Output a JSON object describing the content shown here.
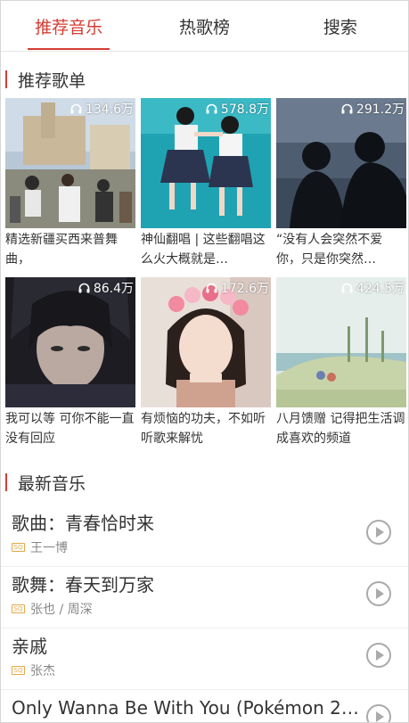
{
  "tabs": [
    {
      "label": "推荐音乐",
      "active": true
    },
    {
      "label": "热歌榜",
      "active": false
    },
    {
      "label": "搜索",
      "active": false
    }
  ],
  "sections": {
    "recommend": "推荐歌单",
    "latest": "最新音乐"
  },
  "playlists": [
    {
      "count": "134.6万",
      "title": "精选新疆买西来普舞曲，"
    },
    {
      "count": "578.8万",
      "title": "神仙翻唱 | 这些翻唱这么火大概就是…"
    },
    {
      "count": "291.2万",
      "title": "“没有人会突然不爱你，只是你突然…"
    },
    {
      "count": "86.4万",
      "title": "我可以等 可你不能一直没有回应"
    },
    {
      "count": "172.6万",
      "title": "有烦恼的功夫，不如听听歌来解忧"
    },
    {
      "count": "424.5万",
      "title": "八月馈赠 记得把生活调成喜欢的频道"
    }
  ],
  "songs": [
    {
      "name": "歌曲：青春恰时来",
      "artist": "王一博"
    },
    {
      "name": "歌舞：春天到万家",
      "artist": "张也 / 周深"
    },
    {
      "name": "亲戚",
      "artist": "张杰"
    },
    {
      "name": "Only Wanna Be With You (Pokémon 25…",
      "artist": ""
    }
  ],
  "icons": {
    "headphones": "headphones-icon",
    "sq": "sq-badge",
    "play": "play-icon"
  },
  "colors": {
    "accent": "#d43c33",
    "sq_badge": "#e6a74b"
  },
  "badge_text": "SQ"
}
